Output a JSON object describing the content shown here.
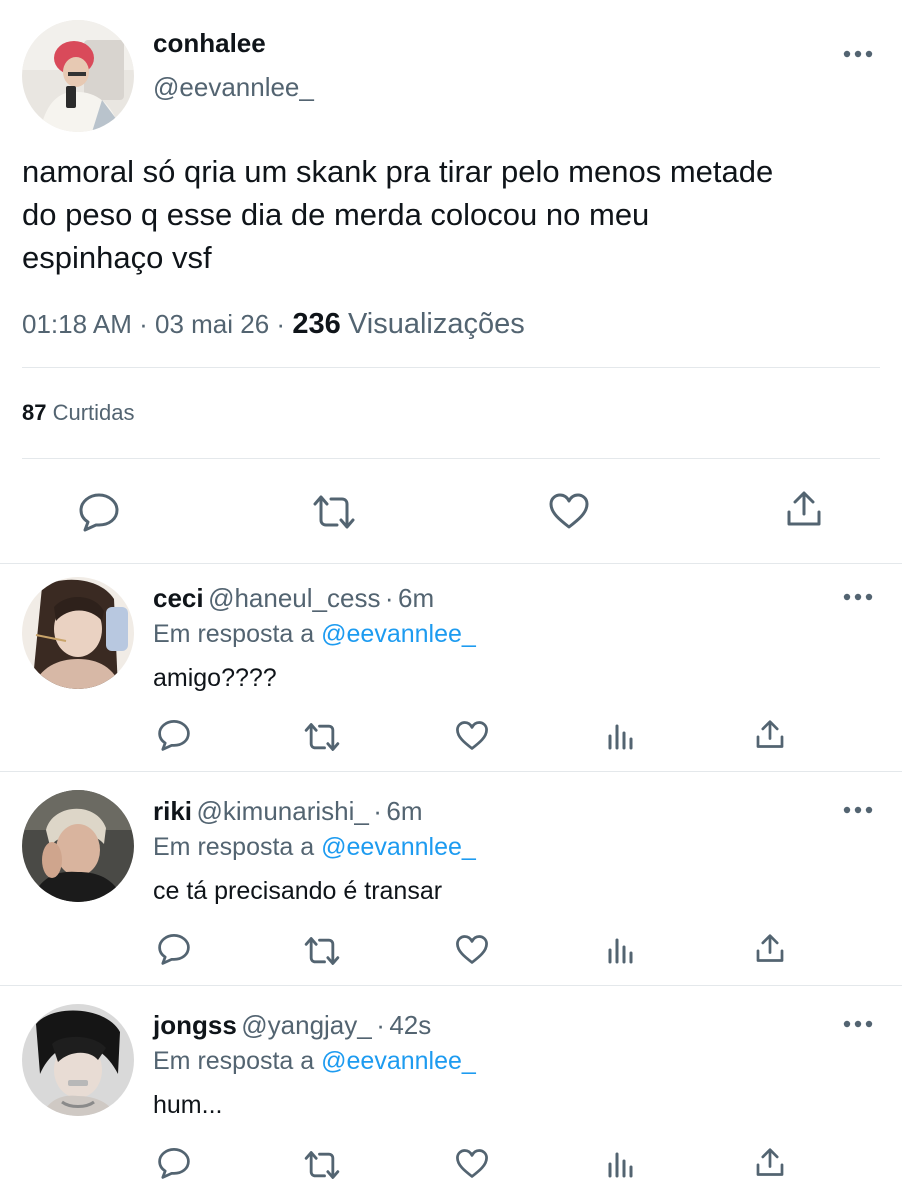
{
  "tweet": {
    "author_name": "conhalee",
    "author_handle": "@eevannlee_",
    "text_lines": [
      "namoral só qria um skank pra tirar pelo menos metade",
      "do peso q esse dia de merda colocou no meu",
      "espinhaço vsf"
    ],
    "time": "01:18 AM",
    "date": "03 mai 26",
    "views_count": "236",
    "views_label": "Visualizações",
    "likes_count": "87",
    "likes_label": "Curtidas",
    "icons": [
      "reply-icon",
      "retweet-icon",
      "like-icon",
      "share-icon"
    ]
  },
  "replies": [
    {
      "name": "ceci",
      "handle": "@haneul_cess",
      "time": "6m",
      "reply_prefix": "Em resposta a",
      "reply_to": "@eevannlee_",
      "text": "amigo????"
    },
    {
      "name": "riki",
      "handle": "@kimunarishi_",
      "time": "6m",
      "reply_prefix": "Em resposta a",
      "reply_to": "@eevannlee_",
      "text": "ce tá precisando é transar"
    },
    {
      "name": "jongss",
      "handle": "@yangjay_",
      "time": "42s",
      "reply_prefix": "Em resposta a",
      "reply_to": "@eevannlee_",
      "text": "hum..."
    }
  ],
  "separator": "·",
  "colors": {
    "accent": "#1d9bf0",
    "muted": "#536471",
    "text": "#0f1419",
    "divider": "#e4e8eb"
  }
}
